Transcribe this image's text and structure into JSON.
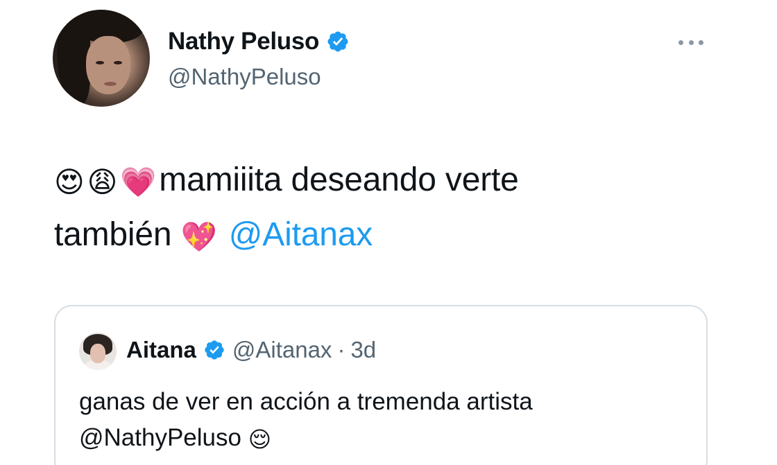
{
  "tweet": {
    "author": {
      "display_name": "Nathy Peluso",
      "handle": "@NathyPeluso",
      "verified": true
    },
    "more_icon": "ellipsis-icon",
    "text": {
      "emojis_leading": [
        "😍",
        "😩",
        "💗"
      ],
      "line1": "mamiiita deseando verte",
      "line2": "también",
      "emoji_sparkle": "💖",
      "mention": "@Aitanax"
    },
    "quote": {
      "author": {
        "display_name": "Aitana",
        "handle": "@Aitanax",
        "separator": "·",
        "time": "3d",
        "verified": true
      },
      "text": {
        "line1": "ganas de ver en acción a tremenda artista",
        "mention": "@NathyPeluso",
        "emoji": "😌"
      }
    }
  },
  "colors": {
    "verified_blue": "#1d9bf0",
    "mention_blue": "#1d9bf0",
    "secondary_text": "#536471",
    "primary_text": "#0f1419",
    "quote_border": "#d6dde3"
  }
}
